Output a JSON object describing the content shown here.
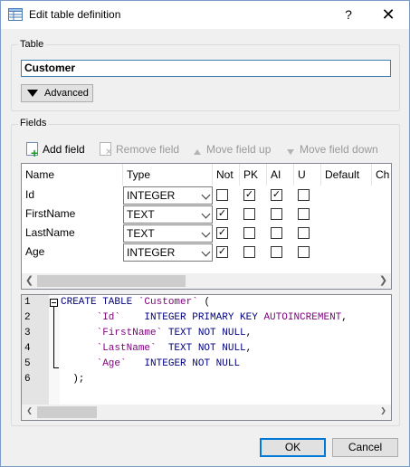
{
  "window": {
    "title": "Edit table definition",
    "help": "?",
    "close": "✕"
  },
  "table": {
    "group_label": "Table",
    "name_value": "Customer",
    "advanced_label": "Advanced"
  },
  "fields": {
    "group_label": "Fields",
    "toolbar": {
      "add": "Add field",
      "remove": "Remove field",
      "up": "Move field up",
      "down": "Move field down"
    },
    "columns": [
      "Name",
      "Type",
      "Not",
      "PK",
      "AI",
      "U",
      "Default",
      "Ch"
    ],
    "rows": [
      {
        "name": "Id",
        "type": "INTEGER",
        "not": false,
        "pk": true,
        "ai": true,
        "u": false
      },
      {
        "name": "FirstName",
        "type": "TEXT",
        "not": true,
        "pk": false,
        "ai": false,
        "u": false
      },
      {
        "name": "LastName",
        "type": "TEXT",
        "not": true,
        "pk": false,
        "ai": false,
        "u": false
      },
      {
        "name": "Age",
        "type": "INTEGER",
        "not": true,
        "pk": false,
        "ai": false,
        "u": false
      }
    ]
  },
  "sql": {
    "lines": [
      {
        "n": "1",
        "parts": [
          [
            "kw",
            "CREATE TABLE "
          ],
          [
            "id",
            "`Customer`"
          ],
          [
            "p",
            " ("
          ]
        ]
      },
      {
        "n": "2",
        "parts": [
          [
            "p",
            "      "
          ],
          [
            "id",
            "`Id`"
          ],
          [
            "p",
            "    "
          ],
          [
            "kw",
            "INTEGER PRIMARY KEY "
          ],
          [
            "id",
            "AUTOINCREMENT"
          ],
          [
            "p",
            ","
          ]
        ]
      },
      {
        "n": "3",
        "parts": [
          [
            "p",
            "      "
          ],
          [
            "id",
            "`FirstName`"
          ],
          [
            "p",
            " "
          ],
          [
            "kw",
            "TEXT NOT NULL"
          ],
          [
            "p",
            ","
          ]
        ]
      },
      {
        "n": "4",
        "parts": [
          [
            "p",
            "      "
          ],
          [
            "id",
            "`LastName`"
          ],
          [
            "p",
            "  "
          ],
          [
            "kw",
            "TEXT NOT NULL"
          ],
          [
            "p",
            ","
          ]
        ]
      },
      {
        "n": "5",
        "parts": [
          [
            "p",
            "      "
          ],
          [
            "id",
            "`Age`"
          ],
          [
            "p",
            "   "
          ],
          [
            "kw",
            "INTEGER NOT NULL"
          ]
        ]
      },
      {
        "n": "6",
        "parts": [
          [
            "p",
            "  );"
          ]
        ]
      }
    ]
  },
  "buttons": {
    "ok": "OK",
    "cancel": "Cancel"
  },
  "colors": {
    "focus_border": "#0078d7",
    "keyword": "#00007f",
    "identifier": "#7f007f",
    "add_icon": "#1e9b24"
  }
}
